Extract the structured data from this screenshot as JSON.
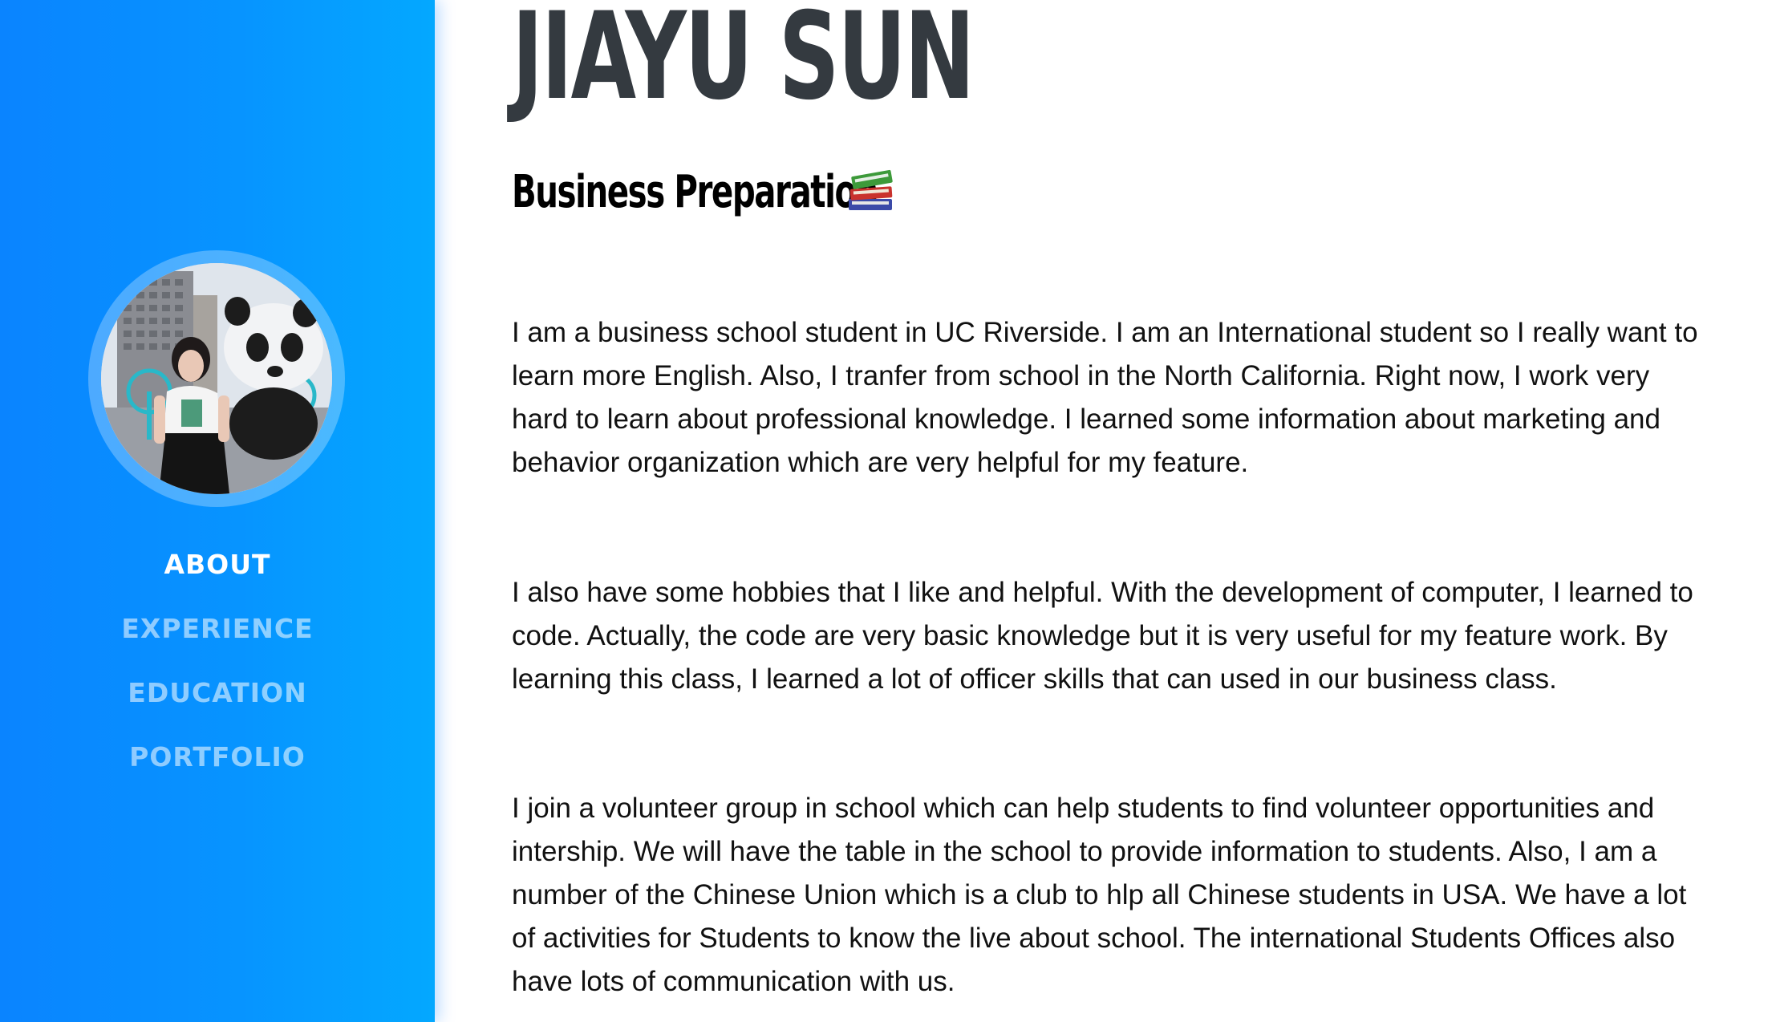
{
  "profile": {
    "name": "JIAYU SUN",
    "subtitle": "Business Preparation",
    "subtitle_icon": "books-icon",
    "avatar_alt": "profile-photo"
  },
  "nav": {
    "items": [
      {
        "label": "ABOUT",
        "active": true
      },
      {
        "label": "EXPERIENCE",
        "active": false
      },
      {
        "label": "EDUCATION",
        "active": false
      },
      {
        "label": "PORTFOLIO",
        "active": false
      }
    ]
  },
  "about": {
    "paragraphs": [
      "I am a business school student in UC Riverside. I am an International student so I really want to learn more English. Also, I tranfer from school in the North California. Right now, I work very hard to learn about professional knowledge. I learned some information about marketing and behavior organization which are very helpful for my feature.",
      "I also have some hobbies that I like and helpful. With the development of computer, I learned to code. Actually, the code are very basic knowledge but it is very useful for my feature work. By learning this class, I learned a lot of officer skills that can used in our business class.",
      "I join a volunteer group in school which can help students to find volunteer opportunities and intership. We will have the table in the school to provide information to students. Also, I am a number of the Chinese Union which is a club to hlp all Chinese students in USA. We have a lot of activities for Students to know the live about school. The international Students Offices also have lots of communication with us."
    ]
  },
  "colors": {
    "sidebar_start": "#0a84ff",
    "sidebar_end": "#04a8ff",
    "name_text": "#343a40",
    "nav_active": "#ffffff",
    "nav_inactive": "rgba(255,255,255,0.55)"
  }
}
